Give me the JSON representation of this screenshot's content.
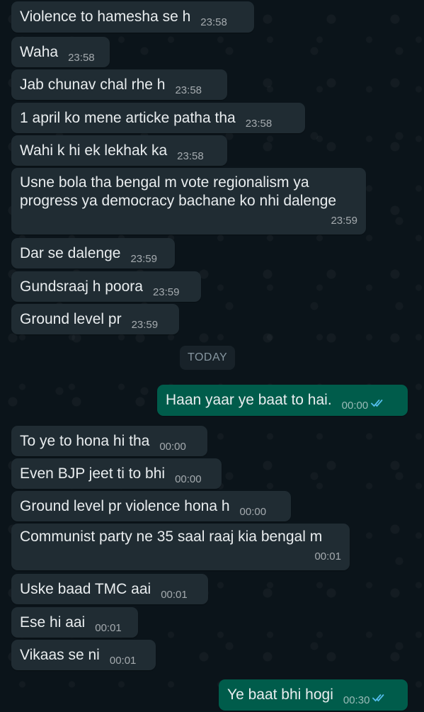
{
  "date_separator": "TODAY",
  "messages": [
    {
      "text": "Violence to hamesha se h",
      "time": "23:58",
      "dir": "in"
    },
    {
      "text": "Waha",
      "time": "23:58",
      "dir": "in"
    },
    {
      "text": "Jab chunav chal rhe h",
      "time": "23:58",
      "dir": "in"
    },
    {
      "text": "1 april ko mene articke patha tha",
      "time": "23:58",
      "dir": "in"
    },
    {
      "text": "Wahi k hi ek lekhak ka",
      "time": "23:58",
      "dir": "in"
    },
    {
      "text": "Usne bola tha bengal m vote regionalism ya progress ya democracy bachane ko nhi dalenge",
      "time": "23:59",
      "dir": "in"
    },
    {
      "text": "Dar se dalenge",
      "time": "23:59",
      "dir": "in"
    },
    {
      "text": "Gundsraaj h poora",
      "time": "23:59",
      "dir": "in"
    },
    {
      "text": "Ground level pr",
      "time": "23:59",
      "dir": "in"
    },
    {
      "text": "Haan yaar ye baat to hai.",
      "time": "00:00",
      "dir": "out",
      "status": "read"
    },
    {
      "text": "To ye to hona hi tha",
      "time": "00:00",
      "dir": "in"
    },
    {
      "text": "Even BJP jeet ti to bhi",
      "time": "00:00",
      "dir": "in"
    },
    {
      "text": "Ground level pr violence hona h",
      "time": "00:00",
      "dir": "in"
    },
    {
      "text": "Communist party ne 35 saal raaj kia bengal m",
      "time": "00:01",
      "dir": "in"
    },
    {
      "text": "Uske baad TMC aai",
      "time": "00:01",
      "dir": "in"
    },
    {
      "text": "Ese hi aai",
      "time": "00:01",
      "dir": "in"
    },
    {
      "text": "Vikaas se ni",
      "time": "00:01",
      "dir": "in"
    },
    {
      "text": "Ye baat bhi hogi",
      "time": "00:30",
      "dir": "out",
      "status": "read"
    }
  ],
  "colors": {
    "background": "#0b141a",
    "incoming_bubble": "#202c33",
    "outgoing_bubble": "#005c4b",
    "read_ticks": "#53bdeb",
    "text": "#e9edef"
  },
  "icons": {
    "read_receipt": "double-check-icon"
  }
}
